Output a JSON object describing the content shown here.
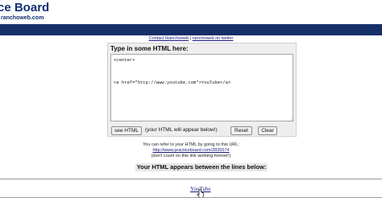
{
  "header": {
    "title": "ce Board",
    "subtitle": "ranchoweb.com"
  },
  "contact": {
    "link1": "Contact Ranchoweb",
    "separator": " | ",
    "link2": "ranchoweb on twitter"
  },
  "form": {
    "label": "Type in some HTML here:",
    "textarea_value": "<center>\n\n\n\n<a href=\"http://www.youtube.com\">YouTube</a>",
    "see_button": "see HTML",
    "appear_text": "(your HTML will appear below!)",
    "reset_button": "Reset",
    "clear_button": "Clear"
  },
  "info": {
    "line1": "You can refer to your HTML by going to this URL:",
    "url": "http://www.practiceboard.com/2826574",
    "line3": "(don't count on this link working forever!)"
  },
  "output": {
    "header": "Your HTML appears between the lines below:",
    "link_text": "YouTube"
  },
  "colors": {
    "brand": "#152f69",
    "link": "#1a1a80"
  }
}
